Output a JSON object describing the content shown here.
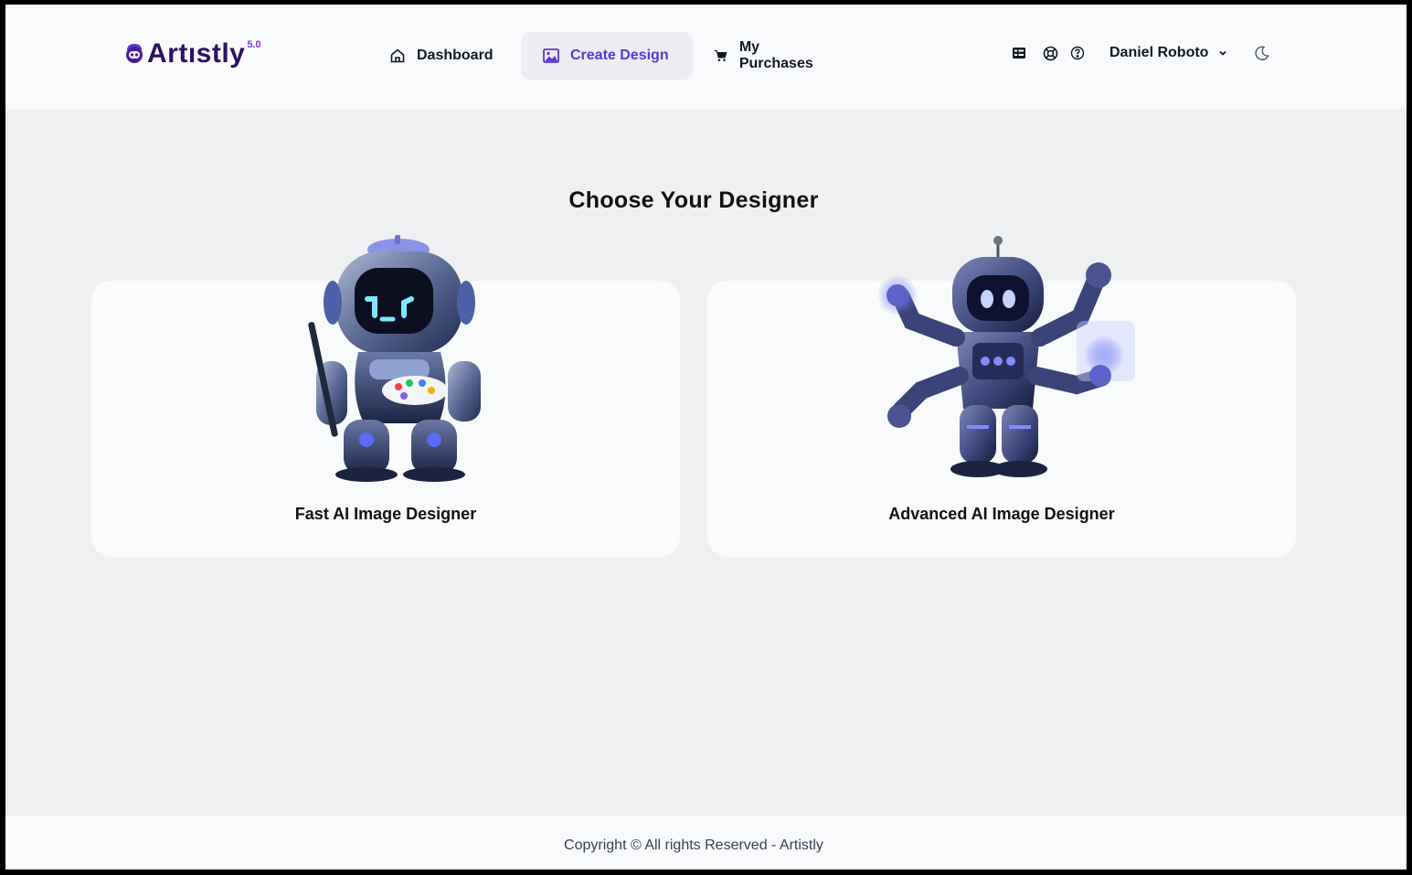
{
  "brand": {
    "name": "Artıstly",
    "version": "5.0",
    "accent": "#5b35d5",
    "logo_color": "#2e1065"
  },
  "nav": {
    "items": [
      {
        "label": "Dashboard",
        "icon": "home-icon",
        "active": false
      },
      {
        "label": "Create Design",
        "icon": "image-icon",
        "active": true
      },
      {
        "label": "My Purchases",
        "icon": "cart-icon",
        "active": false
      }
    ]
  },
  "utilities": [
    {
      "icon": "table-icon"
    },
    {
      "icon": "support-icon"
    },
    {
      "icon": "help-circle-icon"
    }
  ],
  "user": {
    "name": "Daniel Roboto",
    "icon": "chevron-down-icon"
  },
  "theme_toggle": {
    "icon": "moon-icon"
  },
  "main": {
    "title": "Choose Your Designer",
    "designers": [
      {
        "label": "Fast AI Image Designer",
        "image": "painter-robot-illustration"
      },
      {
        "label": "Advanced AI Image Designer",
        "image": "multi-arm-robot-illustration"
      }
    ]
  },
  "footer": {
    "text": "Copyright © All rights Reserved - Artistly"
  }
}
